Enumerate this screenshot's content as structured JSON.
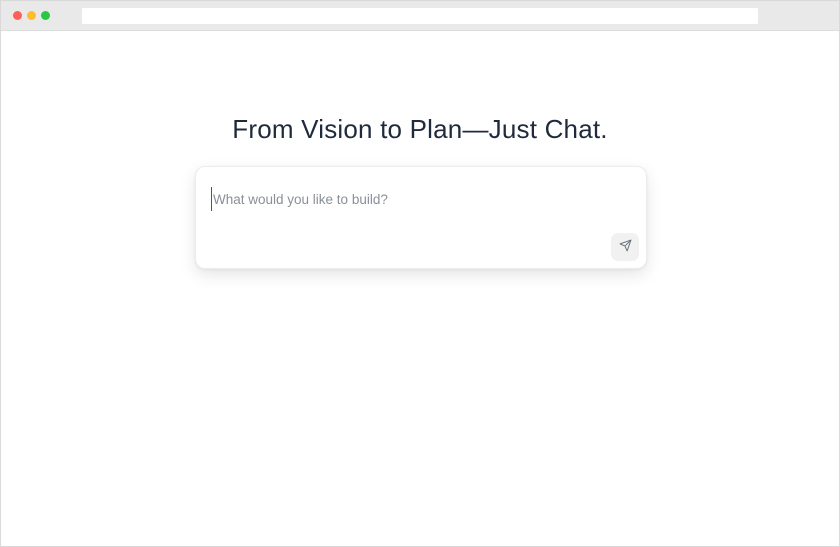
{
  "browser": {
    "address": ""
  },
  "hero": {
    "headline": "From Vision to Plan—Just Chat."
  },
  "prompt": {
    "placeholder": "What would you like to build?",
    "value": "",
    "send_icon": "send-icon"
  },
  "colors": {
    "heading": "#1f2a3c",
    "placeholder": "#8a8f98",
    "send_button_bg": "#f1f1f1"
  }
}
